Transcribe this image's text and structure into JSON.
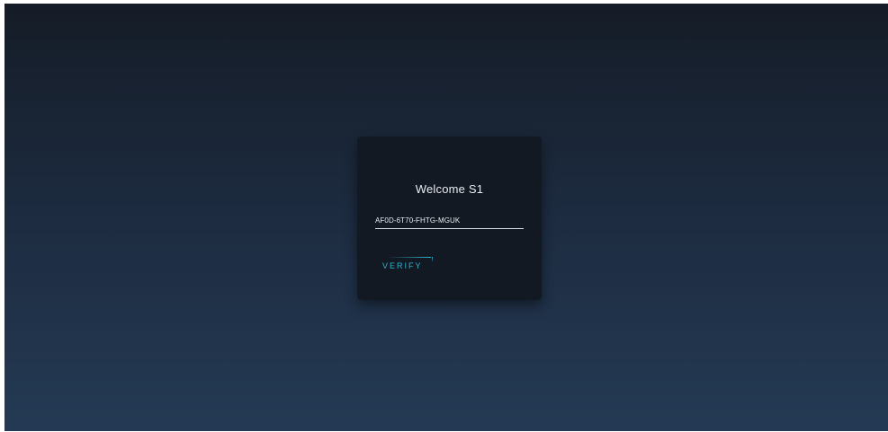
{
  "login": {
    "welcome_text": "Welcome S1",
    "code_value": "AF0D-6T70-FHTG-MGUK",
    "verify_label": "VERIFY"
  },
  "colors": {
    "background_top": "#151c27",
    "background_bottom": "#243a54",
    "card": "#121923",
    "accent": "#2fb6cf"
  }
}
